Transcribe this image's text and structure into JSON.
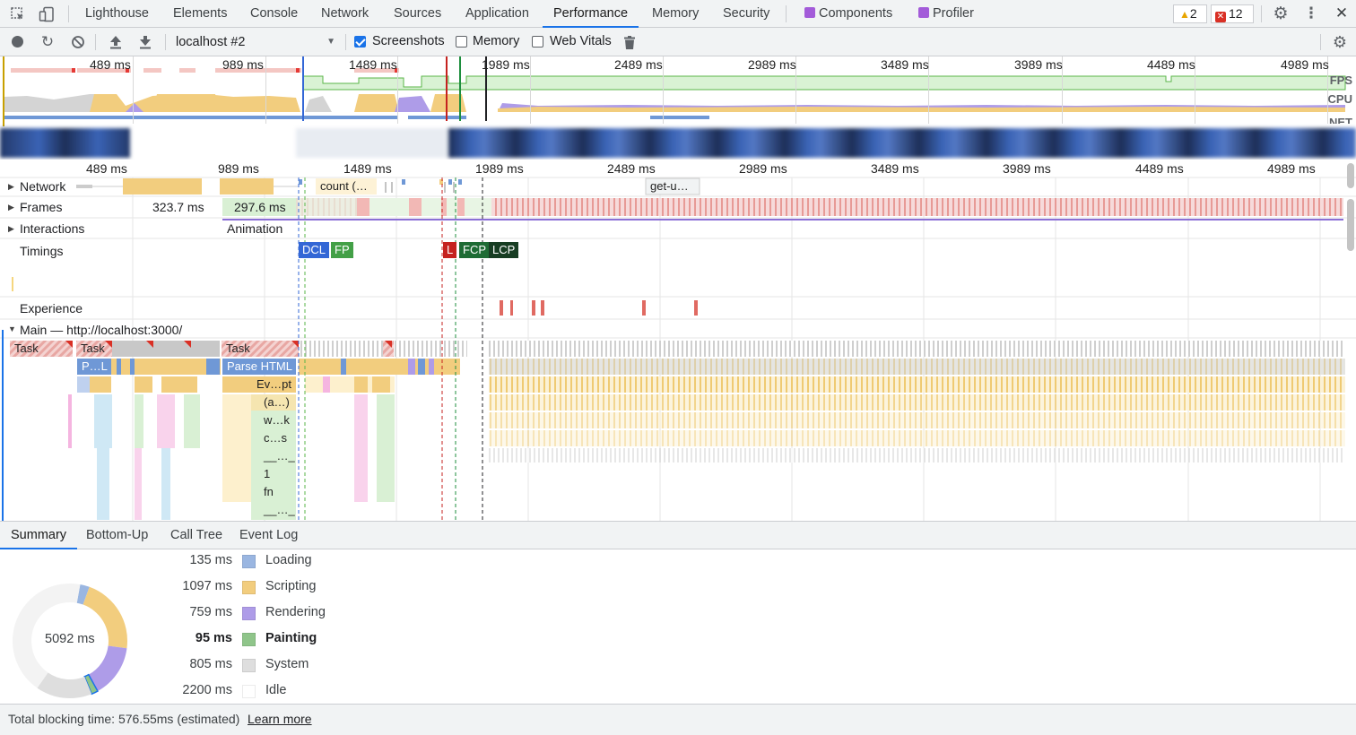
{
  "tabs": {
    "items": [
      "Lighthouse",
      "Elements",
      "Console",
      "Network",
      "Sources",
      "Application",
      "Performance",
      "Memory",
      "Security",
      "Components",
      "Profiler"
    ],
    "active": "Performance",
    "warnings": "2",
    "errors": "12"
  },
  "toolbar": {
    "profile_select": "localhost #2",
    "screenshots_label": "Screenshots",
    "screenshots_checked": true,
    "memory_label": "Memory",
    "memory_checked": false,
    "webvitals_label": "Web Vitals",
    "webvitals_checked": false
  },
  "overview": {
    "ticks": [
      "489 ms",
      "989 ms",
      "1489 ms",
      "1989 ms",
      "2489 ms",
      "2989 ms",
      "3489 ms",
      "3989 ms",
      "4489 ms",
      "4989 ms"
    ],
    "lane_labels": [
      "FPS",
      "CPU",
      "NET"
    ]
  },
  "flame": {
    "ticks": [
      "489 ms",
      "989 ms",
      "1489 ms",
      "1989 ms",
      "2489 ms",
      "2989 ms",
      "3489 ms",
      "3989 ms",
      "4489 ms",
      "4989 ms"
    ],
    "tracks": {
      "network": "Network",
      "frames": "Frames",
      "interactions": "Interactions",
      "timings": "Timings",
      "experience": "Experience",
      "main": "Main — http://localhost:3000/"
    },
    "network_labels": [
      "count (…",
      "get-u…"
    ],
    "frame_values": [
      "323.7 ms",
      "297.6 ms"
    ],
    "interaction_label": "Animation",
    "timing_markers": [
      "DCL",
      "FP",
      "L",
      "FCP",
      "LCP"
    ],
    "main_bars": [
      "Task",
      "Task",
      "Task",
      "P…L",
      "Parse HTML",
      "Ev…pt",
      "(a…)",
      "w…k",
      "c…s",
      "__…_",
      "1",
      "fn",
      "__…_"
    ]
  },
  "summary": {
    "tabs": [
      "Summary",
      "Bottom-Up",
      "Call Tree",
      "Event Log"
    ],
    "active_tab": "Summary",
    "total": "5092 ms",
    "rows": [
      {
        "value": "135 ms",
        "name": "Loading",
        "color": "#9ab6e1"
      },
      {
        "value": "1097 ms",
        "name": "Scripting",
        "color": "#f2cd7e"
      },
      {
        "value": "759 ms",
        "name": "Rendering",
        "color": "#ae9ce8"
      },
      {
        "value": "95 ms",
        "name": "Painting",
        "color": "#8fc58a"
      },
      {
        "value": "805 ms",
        "name": "System",
        "color": "#dedede"
      },
      {
        "value": "2200 ms",
        "name": "Idle",
        "color": "#ffffff"
      }
    ],
    "footer_text": "Total blocking time: 576.55ms (estimated)",
    "learn_more": "Learn more"
  }
}
